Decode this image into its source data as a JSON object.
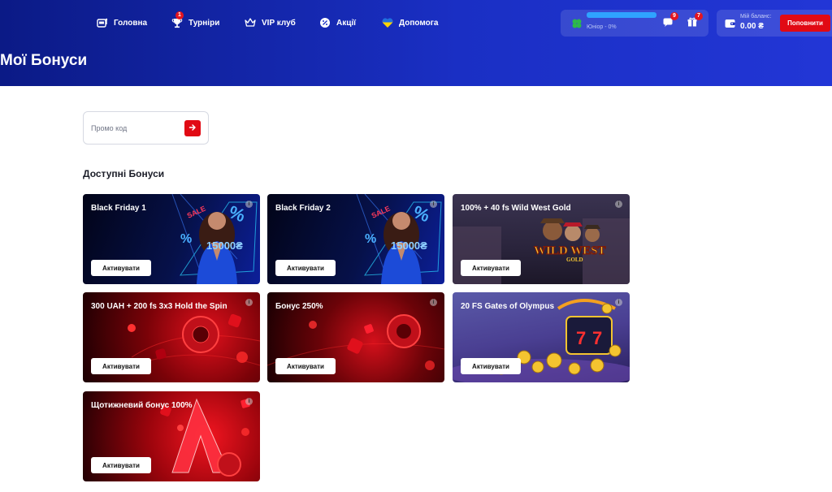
{
  "nav": {
    "items": [
      {
        "label": "Головна",
        "icon": "slot-machine-icon"
      },
      {
        "label": "Турніри",
        "icon": "trophy-icon",
        "badge": "1"
      },
      {
        "label": "VIP клуб",
        "icon": "crown-icon"
      },
      {
        "label": "Акції",
        "icon": "percent-badge-icon"
      },
      {
        "label": "Допомога",
        "icon": "ukraine-heart-icon"
      }
    ]
  },
  "user": {
    "level": "Юніор - 0%",
    "messages_badge": "9",
    "gifts_badge": "7"
  },
  "balance": {
    "label": "Мій баланс:",
    "value": "0.00 ₴",
    "topup_label": "Поповнити"
  },
  "page": {
    "title": "Мої Бонуси"
  },
  "promo": {
    "placeholder": "Промо код"
  },
  "bonuses": {
    "section_title": "Доступні Бонуси",
    "activate_label": "Активувати",
    "cards": [
      {
        "title": "Black Friday 1",
        "theme": "black-friday"
      },
      {
        "title": "Black Friday 2",
        "theme": "black-friday"
      },
      {
        "title": "100% + 40 fs Wild West Gold",
        "theme": "wild-west",
        "art_text": "WILD WEST",
        "art_subtext": "GOLD"
      },
      {
        "title": "300 UAH + 200 fs 3x3 Hold the Spin",
        "theme": "red-casino"
      },
      {
        "title": "Бонус 250%",
        "theme": "red-casino"
      },
      {
        "title": "20 FS Gates of Olympus",
        "theme": "gates-olympus"
      },
      {
        "title": "Щотижневий бонус 100%",
        "theme": "weekly-red"
      }
    ],
    "black_friday_art": {
      "sale": "SALE",
      "amount": "15000₴",
      "percent": "%"
    }
  },
  "colors": {
    "accent": "#e10a14",
    "header_from": "#0b1a86",
    "header_to": "#2236d6"
  }
}
